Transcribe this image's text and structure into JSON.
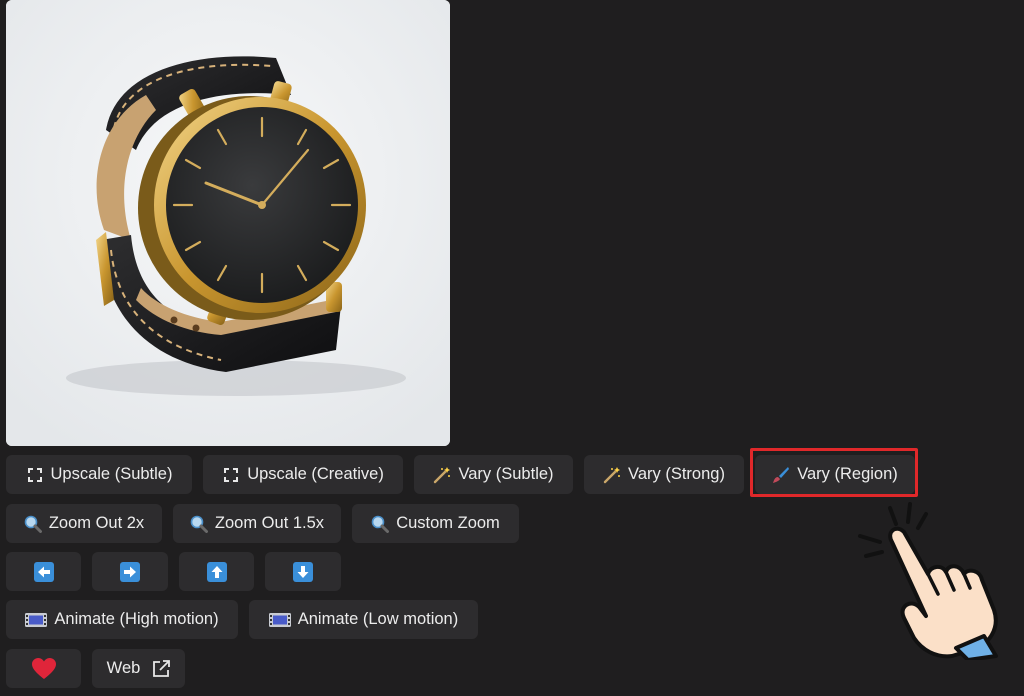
{
  "image": {
    "alt": ""
  },
  "rows": [
    [
      {
        "id": "upscale-subtle",
        "label": "Upscale (Subtle)",
        "icon": "expand-icon"
      },
      {
        "id": "upscale-creative",
        "label": "Upscale (Creative)",
        "icon": "expand-icon"
      },
      {
        "id": "vary-subtle",
        "label": "Vary (Subtle)",
        "icon": "magic-wand-icon"
      },
      {
        "id": "vary-strong",
        "label": "Vary (Strong)",
        "icon": "magic-wand-icon"
      },
      {
        "id": "vary-region",
        "label": "Vary (Region)",
        "icon": "paintbrush-icon",
        "highlighted": true
      }
    ],
    [
      {
        "id": "zoom-out-2x",
        "label": "Zoom Out 2x",
        "icon": "magnifier-icon"
      },
      {
        "id": "zoom-out-1-5x",
        "label": "Zoom Out 1.5x",
        "icon": "magnifier-icon"
      },
      {
        "id": "custom-zoom",
        "label": "Custom Zoom",
        "icon": "magnifier-icon"
      }
    ],
    [
      {
        "id": "pan-left",
        "label": "",
        "icon": "arrow-left-icon"
      },
      {
        "id": "pan-right",
        "label": "",
        "icon": "arrow-right-icon"
      },
      {
        "id": "pan-up",
        "label": "",
        "icon": "arrow-up-icon"
      },
      {
        "id": "pan-down",
        "label": "",
        "icon": "arrow-down-icon"
      }
    ],
    [
      {
        "id": "animate-high",
        "label": "Animate (High motion)",
        "icon": "film-icon"
      },
      {
        "id": "animate-low",
        "label": "Animate (Low motion)",
        "icon": "film-icon"
      }
    ],
    [
      {
        "id": "favorite",
        "label": "",
        "icon": "heart-icon"
      },
      {
        "id": "web",
        "label": "Web",
        "icon": "external-link-icon"
      }
    ]
  ],
  "colors": {
    "background": "#1f1e1f",
    "button": "#2d2c2e",
    "highlight_border": "#e0282a",
    "arrow_blue": "#3a8fd9",
    "heart_red": "#e0253a"
  }
}
